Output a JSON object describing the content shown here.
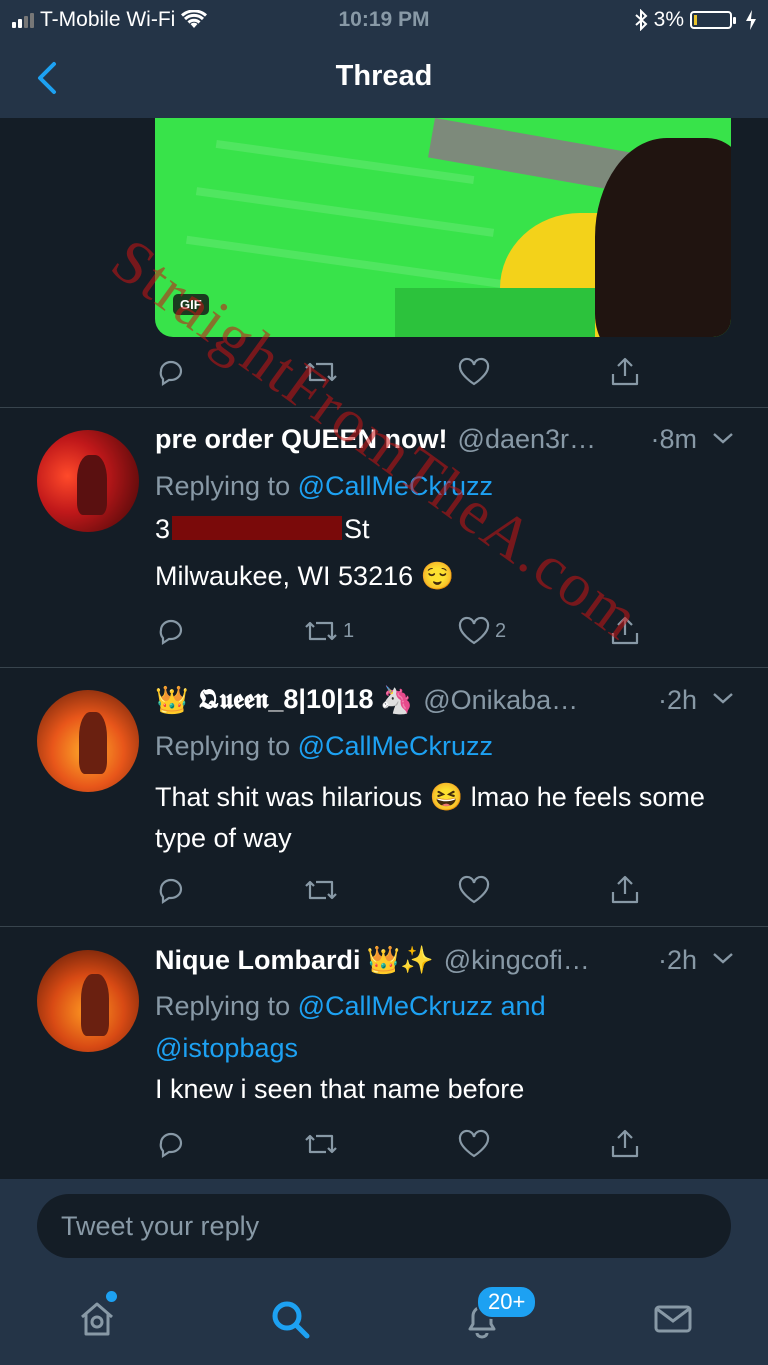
{
  "status_bar": {
    "carrier": "T-Mobile Wi-Fi",
    "time": "10:19 PM",
    "battery": "3%",
    "battery_level": 0.03
  },
  "nav": {
    "title": "Thread"
  },
  "media": {
    "badge": "GIF"
  },
  "tweets": [
    {
      "name": "pre order QUEEN now!",
      "handle": "@daen3r…",
      "time": "·8m",
      "replying_label": "Replying to",
      "mention1": "@CallMeCkruzz",
      "line1_start": "3",
      "line1_end": "St",
      "line2": "Milwaukee, WI 53216 😌",
      "retweets": "1",
      "likes": "2"
    },
    {
      "name_prefix": "👑",
      "name": "𝕼𝖚𝖊𝖊𝖓_8|10|18",
      "name_suffix": "🦄",
      "handle": "@Onikaba…",
      "time": "·2h",
      "replying_label": "Replying to",
      "mention1": "@CallMeCkruzz",
      "body": "That shit was hilarious 😆 lmao he feels some type of way"
    },
    {
      "name": "Nique Lombardi",
      "name_suffix": "👑✨",
      "handle": "@kingcofi…",
      "time": "·2h",
      "replying_label": "Replying to",
      "mention1": "@CallMeCkruzz and",
      "mention2": "@istopbags",
      "body": "I knew i seen that name before"
    }
  ],
  "reply_box": {
    "placeholder": "Tweet your reply"
  },
  "tabbar": {
    "notifications_badge": "20+"
  },
  "watermark": "StraightFromTheA.com",
  "colors": {
    "background": "#141d26",
    "bar": "#243447",
    "accent": "#1da1f2",
    "muted": "#8899a6"
  }
}
